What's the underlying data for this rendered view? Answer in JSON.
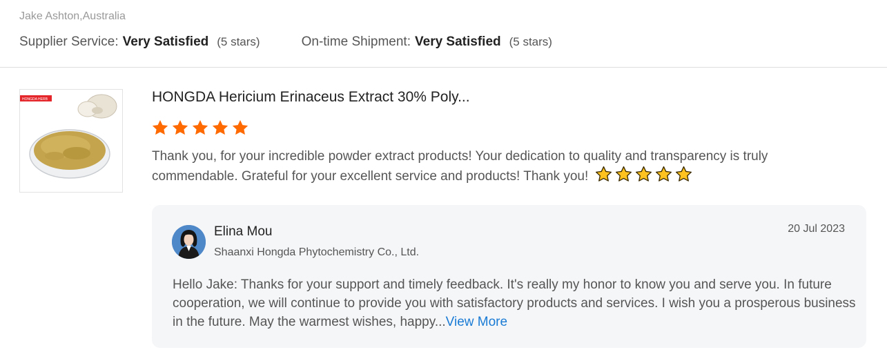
{
  "reviewer": {
    "name_location": "Jake Ashton,Australia"
  },
  "ratings": [
    {
      "label": "Supplier Service:",
      "value": "Very Satisfied",
      "stars_note": "(5 stars)",
      "stars": 5
    },
    {
      "label": "On-time Shipment:",
      "value": "Very Satisfied",
      "stars_note": "(5 stars)",
      "stars": 5
    }
  ],
  "product": {
    "title": "HONGDA Hericium Erinaceus Extract 30% Poly...",
    "image_badge": "HONGDA HERB",
    "rating": 5,
    "star_color": "#ff6a00"
  },
  "review": {
    "text": "Thank you, for your incredible powder extract products! Your dedication to quality and transparency is truly commendable. Grateful for your excellent service and products! Thank you!",
    "emoji": "star-emoji",
    "emoji_count": 5
  },
  "reply": {
    "name": "Elina Mou",
    "company": "Shaanxi Hongda Phytochemistry Co., Ltd.",
    "date": "20 Jul 2023",
    "text": "Hello Jake:   Thanks for your support and timely feedback. It's really my honor to know you and serve you. In future cooperation, we will continue to provide you with satisfactory products and services. I wish you a prosperous business in the future. May the warmest wishes, happy...",
    "view_more": "View More",
    "link_color": "#1a7bd5"
  }
}
